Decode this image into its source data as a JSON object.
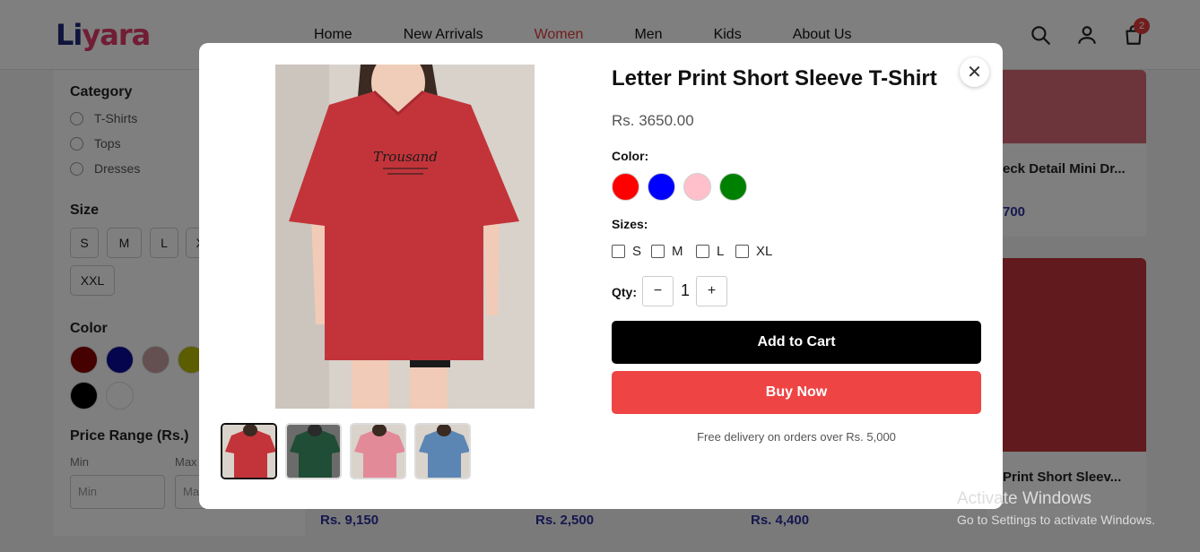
{
  "header": {
    "logo_part1": "Li",
    "logo_part2": "yara",
    "nav": [
      "Home",
      "New Arrivals",
      "Women",
      "Men",
      "Kids",
      "About Us"
    ],
    "cart_count": "2"
  },
  "sidebar": {
    "category_heading": "Category",
    "categories": [
      "T-Shirts",
      "Tops",
      "Dresses"
    ],
    "size_heading": "Size",
    "sizes": [
      "S",
      "M",
      "L",
      "XL",
      "XXL"
    ],
    "color_heading": "Color",
    "colors": [
      "#8b0000",
      "#0a0a9a",
      "#c8a0a0",
      "#b8b800",
      "#000000",
      "#ffffff"
    ],
    "price_heading": "Price Range (Rs.)",
    "min_label": "Min",
    "max_label": "Max",
    "min_placeholder": "Min",
    "max_placeholder": "Max"
  },
  "background_products": {
    "card1_title": "eck Detail Mini Dr...",
    "card1_price": "700",
    "card2_title": "Print Short Sleev...",
    "bottom_prices": [
      "Rs. 9,150",
      "Rs. 2,500",
      "Rs. 4,400"
    ]
  },
  "modal": {
    "title": "Letter Print Short Sleeve T-Shirt",
    "price": "Rs. 3650.00",
    "color_label": "Color:",
    "colors": [
      "#ff0000",
      "#0000ff",
      "#ffc0cb",
      "#008000"
    ],
    "sizes_label": "Sizes:",
    "sizes": [
      "S",
      "M",
      "L",
      "XL"
    ],
    "qty_label": "Qty:",
    "qty_minus": "−",
    "qty_value": "1",
    "qty_plus": "+",
    "add_to_cart": "Add to Cart",
    "buy_now": "Buy Now",
    "delivery_note": "Free delivery on orders over Rs. 5,000",
    "close_symbol": "✕",
    "thumbnails": [
      "red",
      "dark-green",
      "pink",
      "blue"
    ],
    "shirt_print": "Trousand"
  },
  "watermark": {
    "line1": "Activate Windows",
    "line2": "Go to Settings to activate Windows."
  }
}
